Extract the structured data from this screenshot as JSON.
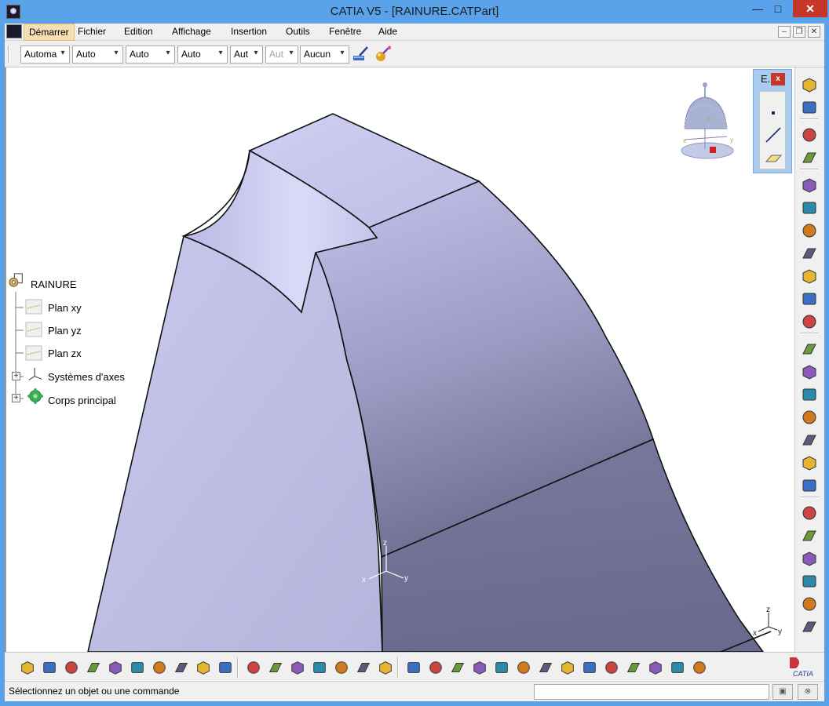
{
  "window": {
    "title": "CATIA V5 - [RAINURE.CATPart]",
    "minimize_glyph": "—",
    "maximize_glyph": "□",
    "close_glyph": "✕"
  },
  "menu": {
    "items": [
      "Démarrer",
      "Fichier",
      "Edition",
      "Affichage",
      "Insertion",
      "Outils",
      "Fenêtre",
      "Aide"
    ],
    "mdi_minimize": "–",
    "mdi_restore": "❐",
    "mdi_close": "✕"
  },
  "properties_toolbar": {
    "combos": [
      "Automa",
      "Auto",
      "Auto",
      "Auto",
      "Aut",
      "Aut",
      "Aucun"
    ],
    "arrow": "▾",
    "icons": [
      "painter-brush-icon",
      "graphic-properties-icon"
    ]
  },
  "spec_tree": {
    "root": "RAINURE",
    "plane_xy": "Plan xy",
    "plane_yz": "Plan yz",
    "plane_zx": "Plan zx",
    "axis_systems": "Systèmes d'axes",
    "main_body": "Corps principal",
    "expand_glyph": "+"
  },
  "compass": {
    "axis_x": "x",
    "axis_y": "y",
    "axis_z": "z"
  },
  "triad_origin": {
    "x": "x",
    "y": "y",
    "z": "z"
  },
  "triad_corner": {
    "x": "x",
    "y": "y",
    "z": "z"
  },
  "floating_toolbar": {
    "title": "E.",
    "close": "x",
    "tools": [
      "point-icon",
      "line-icon",
      "plane-icon"
    ]
  },
  "right_toolbar": {
    "icons": [
      "sketcher-icon",
      "select-arrow-icon",
      "sketch-edit-icon",
      "pad-icon",
      "pocket-icon",
      "shaft-icon",
      "groove-icon",
      "hole-icon",
      "rib-icon",
      "slot-icon",
      "fillet-icon",
      "chamfer-icon",
      "draft-icon",
      "shell-icon",
      "thickness-icon",
      "thread-icon",
      "split-icon",
      "thick-surface-icon",
      "close-surface-icon",
      "sew-surface-icon",
      "translate-icon",
      "mirror-icon",
      "pattern-icon",
      "scaling-icon"
    ]
  },
  "bottom_toolbar": {
    "icons": [
      "new-icon",
      "open-icon",
      "save-icon",
      "print-icon",
      "cut-icon",
      "copy-icon",
      "paste-icon",
      "undo-icon",
      "redo-icon",
      "whats-this-icon",
      "formula-icon",
      "knowledge-comment-icon",
      "parameter-icon",
      "design-table-icon",
      "tree-icon",
      "hide-show-icon",
      "measure-icon",
      "fly-icon",
      "fit-all-icon",
      "pan-icon",
      "rotate-icon",
      "zoom-in-icon",
      "zoom-out-icon",
      "normal-view-icon",
      "multi-view-icon",
      "iso-view-icon",
      "shading-icon",
      "edge-shading-icon",
      "surface-shading-icon",
      "swap-visible-icon",
      "analysis-icon",
      "catia-logo"
    ]
  },
  "status": {
    "message": "Sélectionnez un objet ou une commande"
  },
  "colors": {
    "titlebar": "#5aa3ea",
    "part_face_light": "#c6c6ee",
    "part_face_dark": "#7c7ca2",
    "menu_active": "#f5deb3",
    "close_red": "#c7362b"
  }
}
